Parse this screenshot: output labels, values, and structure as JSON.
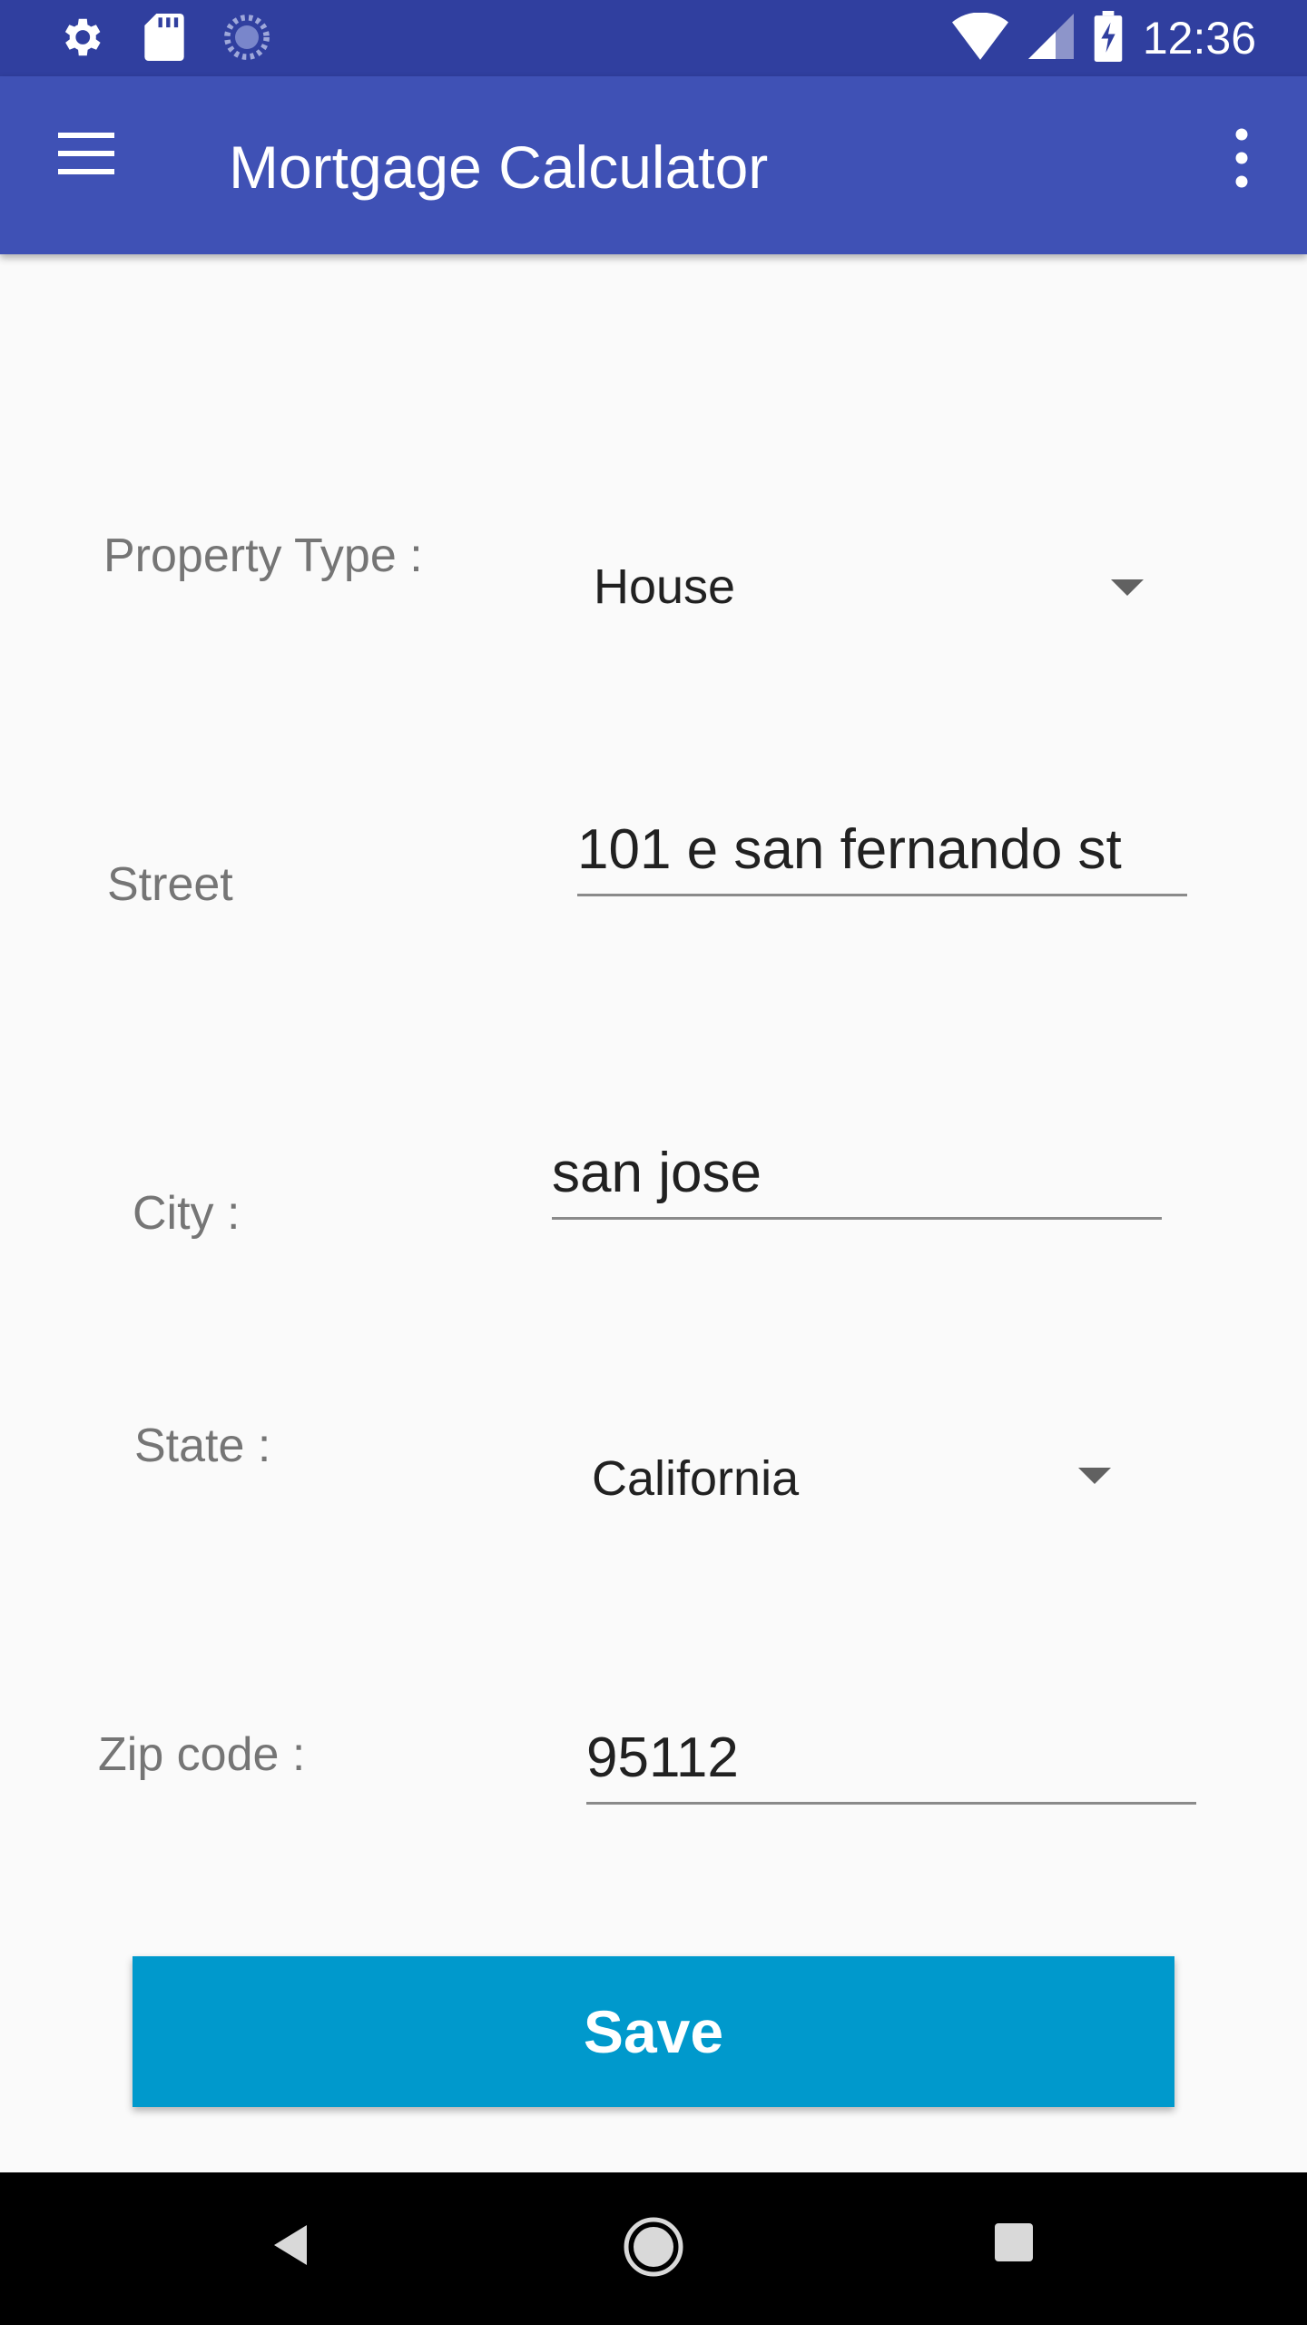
{
  "status_bar": {
    "time": "12:36"
  },
  "app_bar": {
    "title": "Mortgage Calculator"
  },
  "form": {
    "property_type": {
      "label": "Property Type :",
      "value": "House"
    },
    "street": {
      "label": "Street",
      "value": "101 e san fernando st"
    },
    "city": {
      "label": "City :",
      "value": "san jose"
    },
    "state": {
      "label": "State :",
      "value": "California"
    },
    "zip": {
      "label": "Zip code :",
      "value": "95112"
    }
  },
  "save_button": {
    "label": "Save"
  },
  "colors": {
    "status_bar": "#303f9f",
    "app_bar": "#3f51b5",
    "save_button": "#0099cc"
  }
}
